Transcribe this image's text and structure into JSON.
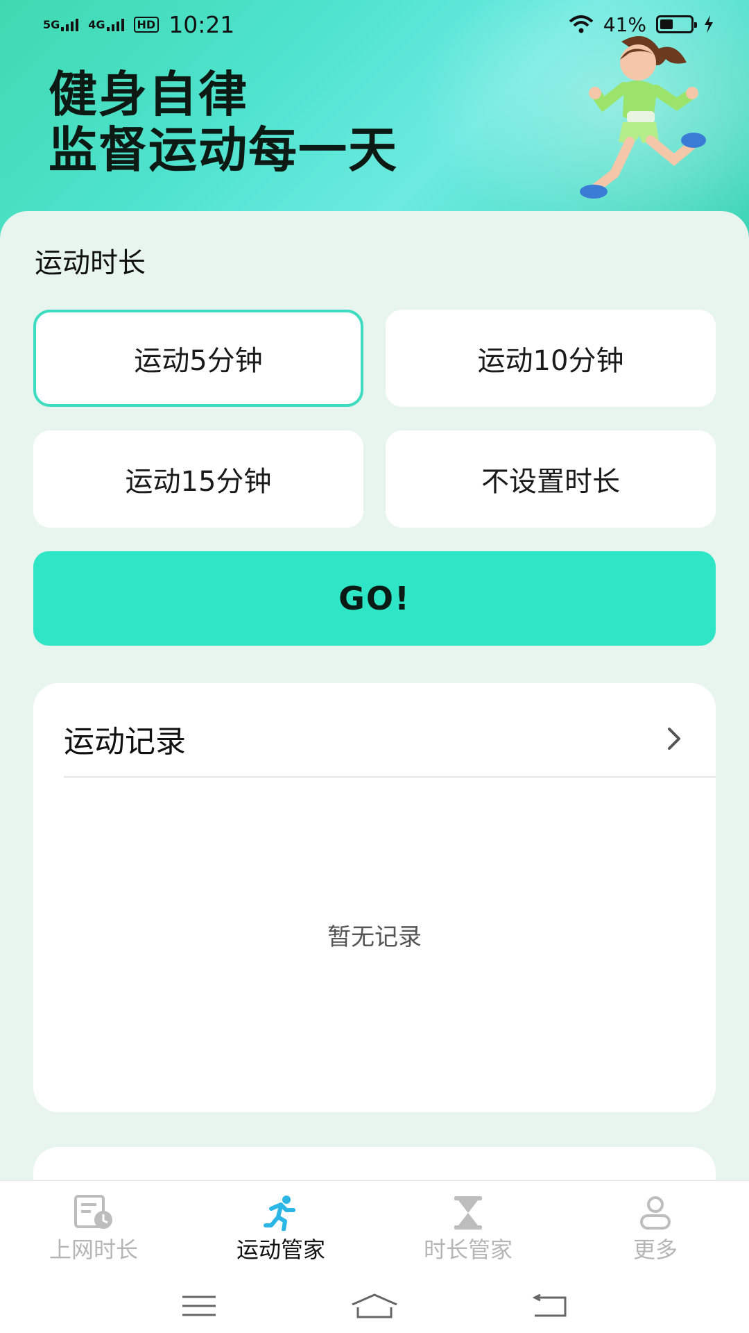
{
  "status_bar": {
    "net1": "5G",
    "net2": "4G",
    "hd": "HD",
    "time": "10:21",
    "battery": "41%"
  },
  "banner": {
    "line1": "健身自律",
    "line2": "监督运动每一天"
  },
  "duration": {
    "title": "运动时长",
    "options": [
      {
        "label": "运动5分钟",
        "selected": true
      },
      {
        "label": "运动10分钟",
        "selected": false
      },
      {
        "label": "运动15分钟",
        "selected": false
      },
      {
        "label": "不设置时长",
        "selected": false
      }
    ],
    "go_label": "GO!"
  },
  "records": {
    "title": "运动记录",
    "empty": "暂无记录"
  },
  "bottom_nav": {
    "tabs": [
      {
        "label": "上网时长",
        "icon": "screen-time-icon",
        "active": false
      },
      {
        "label": "运动管家",
        "icon": "running-icon",
        "active": true
      },
      {
        "label": "时长管家",
        "icon": "hourglass-icon",
        "active": false
      },
      {
        "label": "更多",
        "icon": "profile-icon",
        "active": false
      }
    ]
  },
  "colors": {
    "accent": "#2ee6c6",
    "selected_border": "#3ddcc0",
    "active_icon": "#2bb6e6",
    "inactive": "#b5b5b5"
  }
}
